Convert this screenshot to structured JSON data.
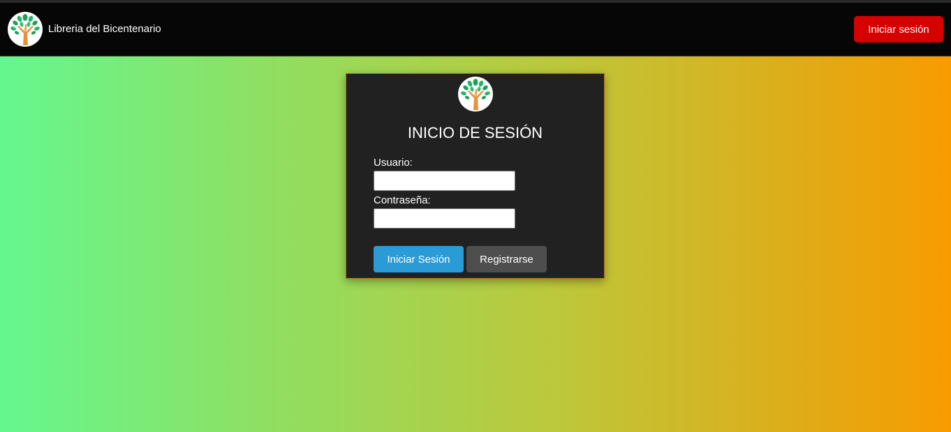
{
  "navbar": {
    "brand_name": "Libreria del Bicentenario",
    "logo_icon": "tree-logo-icon",
    "login_button_label": "Iniciar sesión"
  },
  "login_card": {
    "logo_icon": "tree-logo-icon",
    "title": "INICIO DE SESIÓN",
    "username_label": "Usuario:",
    "username_value": "",
    "password_label": "Contraseña:",
    "password_value": "",
    "submit_label": "Iniciar Sesión",
    "register_label": "Registrarse"
  },
  "colors": {
    "navbar_bg": "#060606",
    "nav_login_button": "#d50000",
    "card_bg": "#212121",
    "card_border": "#b8720c",
    "submit_button": "#2b9bd6",
    "register_button": "#4e4e4e",
    "gradient_start": "#65f78f",
    "gradient_end": "#f89b00"
  }
}
